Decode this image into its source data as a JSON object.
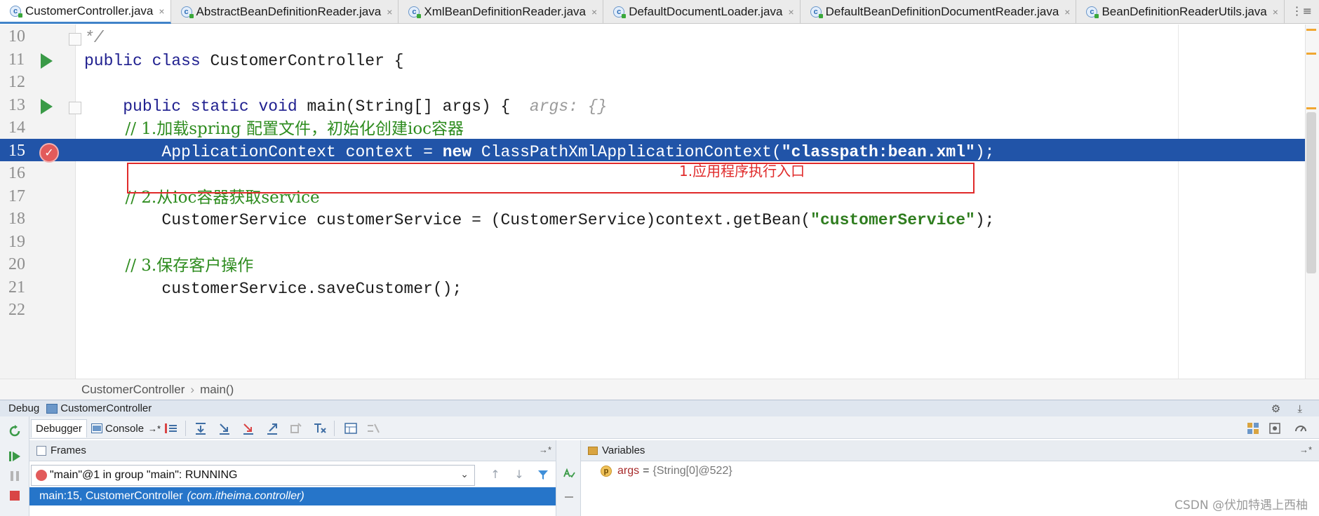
{
  "tabs": [
    {
      "label": "CustomerController.java",
      "active": true
    },
    {
      "label": "AbstractBeanDefinitionReader.java",
      "active": false
    },
    {
      "label": "XmlBeanDefinitionReader.java",
      "active": false
    },
    {
      "label": "DefaultDocumentLoader.java",
      "active": false
    },
    {
      "label": "DefaultBeanDefinitionDocumentReader.java",
      "active": false
    },
    {
      "label": "BeanDefinitionReaderUtils.java",
      "active": false
    }
  ],
  "tab_close_glyph": "×",
  "tab_menu_glyph": "⋮≡",
  "editor": {
    "lines": [
      {
        "num": "10",
        "parts": [
          {
            "t": "*/",
            "c": "gray"
          }
        ]
      },
      {
        "num": "11",
        "parts": [
          {
            "t": "public class ",
            "c": "kw"
          },
          {
            "t": "CustomerController {",
            "c": ""
          }
        ]
      },
      {
        "num": "12",
        "parts": []
      },
      {
        "num": "13",
        "parts": [
          {
            "t": "    public static void ",
            "c": "kw"
          },
          {
            "t": "main(String[] args) {  ",
            "c": ""
          },
          {
            "t": "args: {}",
            "c": "hint"
          }
        ]
      },
      {
        "num": "14",
        "parts": [
          {
            "t": "        // 1.加载spring 配置文件，初始化创建ioc容器",
            "c": "cmt"
          }
        ]
      },
      {
        "num": "15",
        "parts": [
          {
            "t": "        ApplicationContext context = ",
            "c": ""
          },
          {
            "t": "new ",
            "c": "kw"
          },
          {
            "t": "ClassPathXmlApplicationContext(",
            "c": ""
          },
          {
            "t": "\"classpath:bean.xml\"",
            "c": "str"
          },
          {
            "t": ");",
            "c": ""
          }
        ]
      },
      {
        "num": "16",
        "parts": []
      },
      {
        "num": "17",
        "parts": [
          {
            "t": "        // 2.从ioc容器获取service",
            "c": "cmt"
          }
        ]
      },
      {
        "num": "18",
        "parts": [
          {
            "t": "        CustomerService customerService = (CustomerService)context.getBean(",
            "c": ""
          },
          {
            "t": "\"customerService\"",
            "c": "str"
          },
          {
            "t": ");",
            "c": ""
          }
        ]
      },
      {
        "num": "19",
        "parts": []
      },
      {
        "num": "20",
        "parts": [
          {
            "t": "        // 3.保存客户操作",
            "c": "cmt"
          }
        ]
      },
      {
        "num": "21",
        "parts": [
          {
            "t": "        customerService.saveCustomer();",
            "c": ""
          }
        ]
      },
      {
        "num": "22",
        "parts": []
      }
    ],
    "highlight_line": "15",
    "run_lines": [
      "11",
      "13"
    ],
    "breakpoint_line": "15",
    "breakpoint_glyph": "✓",
    "annotation": "1.应用程序执行入口"
  },
  "breadcrumbs": [
    "CustomerController",
    "main()"
  ],
  "breadcrumb_sep": "›",
  "debug": {
    "label": "Debug",
    "config": "CustomerController",
    "header_icons": "⚙ ⤓",
    "tabs": {
      "debugger": "Debugger",
      "console": "Console"
    },
    "console_suffix": "→*",
    "frames": {
      "title": "Frames",
      "pin": "→*",
      "thread": "\"main\"@1 in group \"main\": RUNNING",
      "caret": "⌄",
      "nav_up": "↑",
      "nav_down": "↓",
      "frame": {
        "method": "main:15, CustomerController",
        "package": "(com.itheima.controller)"
      }
    },
    "variables": {
      "title": "Variables",
      "pin": "→*",
      "badge": "p",
      "items": [
        {
          "name": "args",
          "eq": "=",
          "value": "{String[0]@522}"
        }
      ]
    }
  },
  "watermark": "CSDN @伏加特遇上西柚",
  "colors": {
    "accent": "#2154a8",
    "selection": "#2675c9",
    "annotation": "#e02a2a",
    "comment": "#2e8c1f",
    "keyword": "#1f1f8f"
  }
}
